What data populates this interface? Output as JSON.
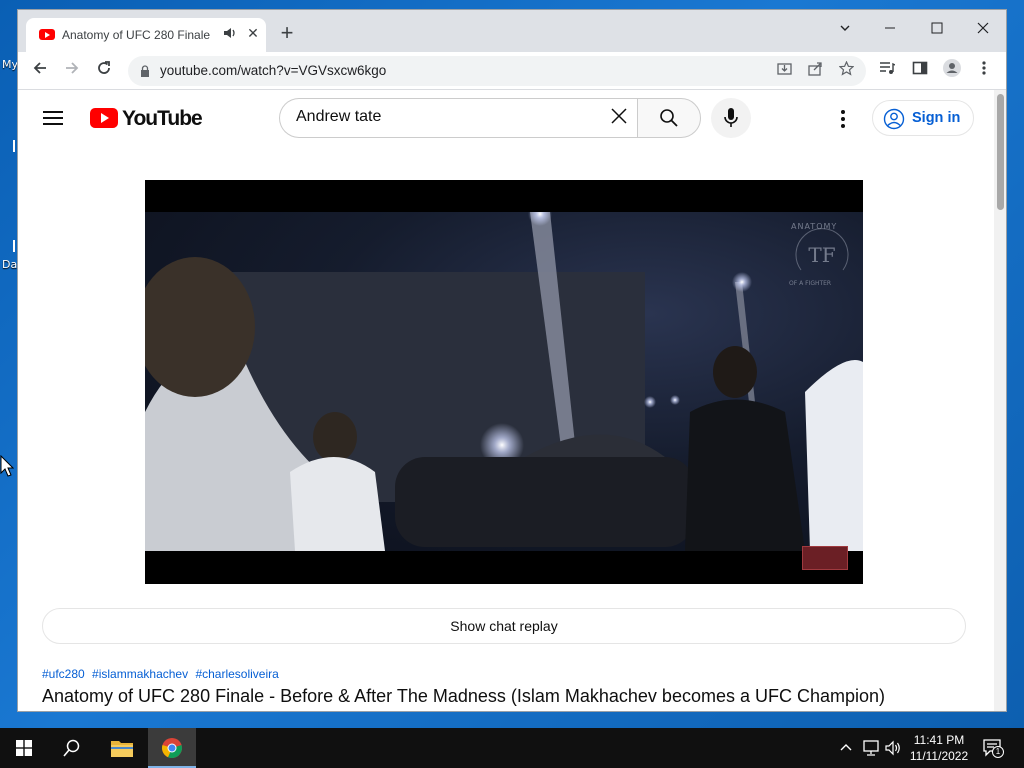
{
  "desktop": {
    "label_top": "My",
    "label_mid": "Da"
  },
  "tab": {
    "title": "Anatomy of UFC 280 Finale -"
  },
  "toolbar": {
    "url": "youtube.com/watch?v=VGVsxcw6kgo"
  },
  "youtube": {
    "logo_text": "YouTube",
    "search_value": "Andrew tate",
    "signin_label": "Sign in"
  },
  "player": {
    "watermark_top": "ANATOMY",
    "watermark_bottom": "OF A FIGHTER"
  },
  "chat_replay": {
    "label": "Show chat replay"
  },
  "video": {
    "hashtags": [
      "#ufc280",
      "#islammakhachev",
      "#charlesoliveira"
    ],
    "title": "Anatomy of UFC 280 Finale - Before & After The Madness (Islam Makhachev becomes a UFC Champion)"
  },
  "taskbar": {
    "time": "11:41 PM",
    "date": "11/11/2022",
    "notification_count": "1"
  },
  "colors": {
    "accent_link": "#065fd4",
    "youtube_red": "#ff0000",
    "taskbar": "#101010"
  }
}
